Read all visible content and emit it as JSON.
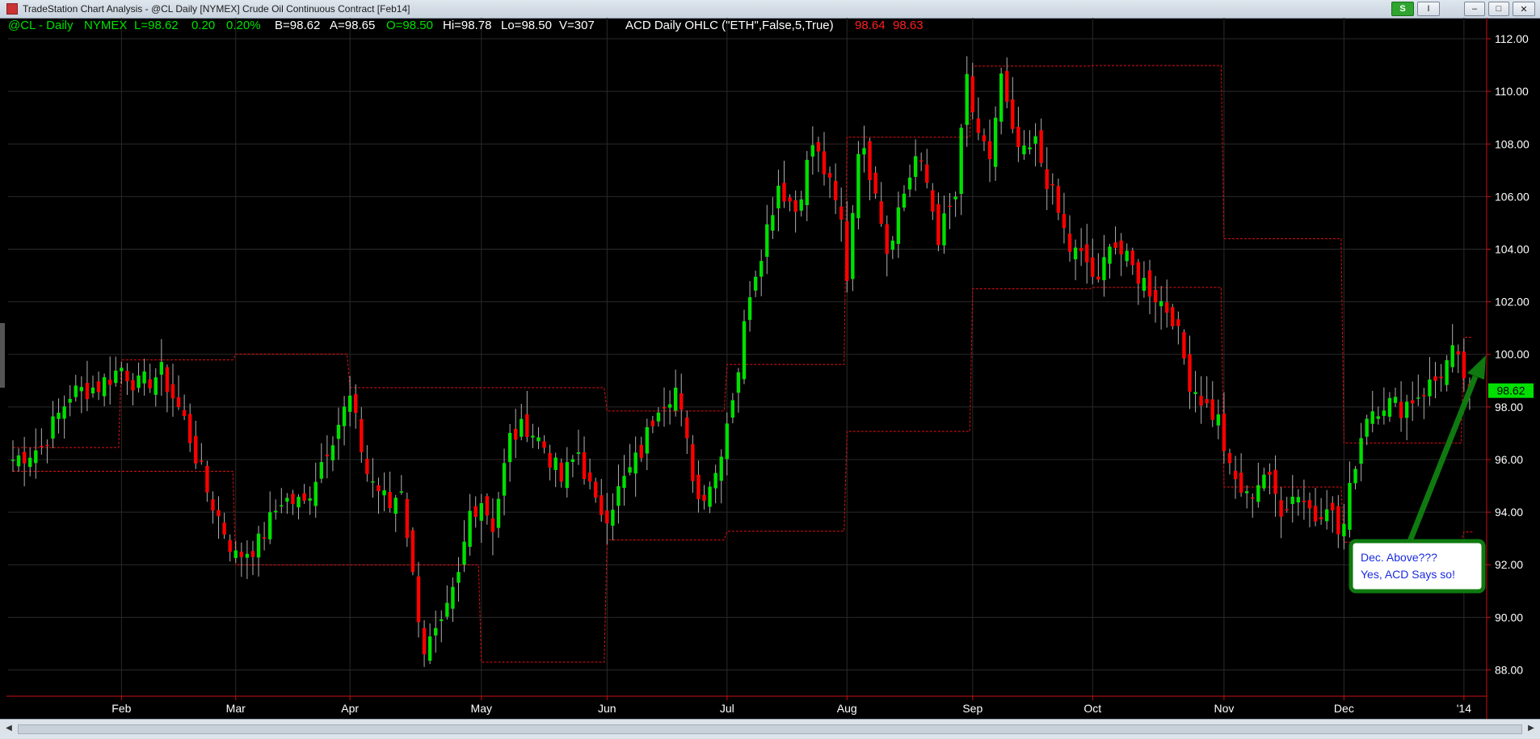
{
  "window": {
    "title": "TradeStation Chart Analysis - @CL Daily [NYMEX] Crude Oil Continuous Contract [Feb14]",
    "buttons": {
      "s_label": "S",
      "i_label": "I",
      "minimize": "–",
      "maximize": "□",
      "close": "✕"
    }
  },
  "status_bar": {
    "symbol": "@CL - Daily",
    "exchange": "NYMEX",
    "last": "L=98.62",
    "change": "0.20",
    "change_pct": "0.20%",
    "bid": "B=98.62",
    "ask": "A=98.65",
    "open": "O=98.50",
    "high": "Hi=98.78",
    "low": "Lo=98.50",
    "volume": "V=307",
    "indicator": "ACD Daily OHLC (\"ETH\",False,5,True)",
    "ind_val1": "98.64",
    "ind_val2": "98.63"
  },
  "colors": {
    "background": "#000000",
    "up_candle": "#00e000",
    "down_candle": "#ff0000",
    "indicator": "#e01010",
    "grid": "#2a2a2a",
    "axis_text": "#ffffff",
    "last_price_bg": "#00e000",
    "annotation_border": "#0f7a0f",
    "annotation_text": "#1a2be0"
  },
  "chart_data": {
    "type": "candlestick",
    "ylim": [
      87.0,
      112.8
    ],
    "y_ticks": [
      88,
      90,
      92,
      94,
      96,
      98,
      100,
      102,
      104,
      106,
      108,
      110,
      112
    ],
    "y_tick_labels": [
      "88.00",
      "90.00",
      "92.00",
      "94.00",
      "96.00",
      "98.00",
      "100.00",
      "102.00",
      "104.00",
      "106.00",
      "108.00",
      "110.00",
      "112.00"
    ],
    "x_ticks": [
      "Feb",
      "Mar",
      "Apr",
      "May",
      "Jun",
      "Jul",
      "Aug",
      "Sep",
      "Oct",
      "Nov",
      "Dec",
      "'14"
    ],
    "x_tick_bar_index": [
      19,
      39,
      59,
      82,
      104,
      125,
      146,
      168,
      189,
      212,
      233,
      254
    ],
    "last_price": 98.62,
    "last_price_label": "98.62",
    "bar_count": 256,
    "close_anchors": [
      [
        0,
        96.0
      ],
      [
        5,
        96.5
      ],
      [
        10,
        98.5
      ],
      [
        15,
        98.8
      ],
      [
        19,
        99.5
      ],
      [
        22,
        98.8
      ],
      [
        26,
        99.3
      ],
      [
        30,
        97.5
      ],
      [
        34,
        94.8
      ],
      [
        39,
        92.3
      ],
      [
        43,
        92.8
      ],
      [
        47,
        94.5
      ],
      [
        51,
        94.3
      ],
      [
        55,
        96.5
      ],
      [
        59,
        98.3
      ],
      [
        62,
        95.5
      ],
      [
        66,
        94.2
      ],
      [
        68,
        95.0
      ],
      [
        70,
        91.5
      ],
      [
        72,
        88.8
      ],
      [
        75,
        89.5
      ],
      [
        78,
        91.5
      ],
      [
        80,
        94.0
      ],
      [
        82,
        94.5
      ],
      [
        84,
        93.5
      ],
      [
        87,
        96.8
      ],
      [
        90,
        97.3
      ],
      [
        93,
        96.5
      ],
      [
        96,
        95.2
      ],
      [
        99,
        96.3
      ],
      [
        102,
        94.2
      ],
      [
        104,
        94.0
      ],
      [
        107,
        95.2
      ],
      [
        110,
        96.3
      ],
      [
        113,
        98.2
      ],
      [
        116,
        98.7
      ],
      [
        118,
        96.5
      ],
      [
        120,
        94.5
      ],
      [
        123,
        95.5
      ],
      [
        125,
        97.5
      ],
      [
        127,
        99.5
      ],
      [
        129,
        102.5
      ],
      [
        131,
        104.0
      ],
      [
        134,
        106.5
      ],
      [
        137,
        105.5
      ],
      [
        140,
        108.0
      ],
      [
        142,
        107.0
      ],
      [
        145,
        105.0
      ],
      [
        146,
        103.0
      ],
      [
        148,
        108.0
      ],
      [
        151,
        106.5
      ],
      [
        153,
        104.0
      ],
      [
        155,
        105.5
      ],
      [
        158,
        107.5
      ],
      [
        160,
        106.5
      ],
      [
        162,
        104.5
      ],
      [
        165,
        106.0
      ],
      [
        167,
        110.5
      ],
      [
        169,
        108.0
      ],
      [
        171,
        107.5
      ],
      [
        173,
        110.5
      ],
      [
        175,
        108.2
      ],
      [
        177,
        107.5
      ],
      [
        179,
        108.0
      ],
      [
        182,
        106.0
      ],
      [
        185,
        104.0
      ],
      [
        188,
        103.5
      ],
      [
        190,
        102.5
      ],
      [
        192,
        104.5
      ],
      [
        195,
        103.5
      ],
      [
        199,
        102.5
      ],
      [
        203,
        101.5
      ],
      [
        206,
        99.0
      ],
      [
        209,
        98.0
      ],
      [
        211,
        97.5
      ],
      [
        213,
        95.5
      ],
      [
        216,
        94.5
      ],
      [
        219,
        95.5
      ],
      [
        222,
        94.2
      ],
      [
        225,
        94.8
      ],
      [
        228,
        93.8
      ],
      [
        230,
        94.5
      ],
      [
        232,
        93.2
      ],
      [
        233,
        93.5
      ],
      [
        235,
        96.0
      ],
      [
        237,
        97.8
      ],
      [
        240,
        98.2
      ],
      [
        243,
        98.0
      ],
      [
        246,
        98.5
      ],
      [
        249,
        99.0
      ],
      [
        252,
        100.0
      ],
      [
        254,
        99.2
      ],
      [
        255,
        98.62
      ]
    ],
    "annotation": {
      "line1": "Dec. Above???",
      "line2": "Yes, ACD Says so!"
    }
  }
}
